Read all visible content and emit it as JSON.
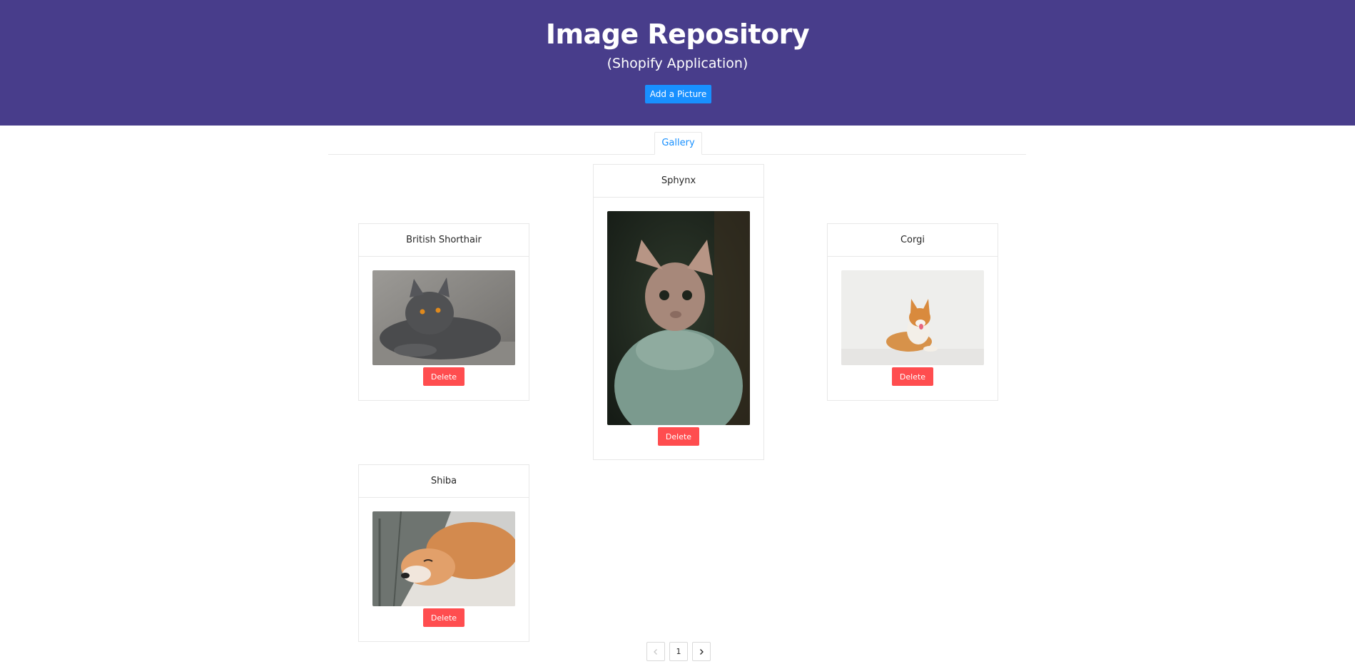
{
  "header": {
    "title": "Image Repository",
    "subtitle": "(Shopify Application)",
    "add_label": "Add a Picture",
    "bg_color": "#483d8b",
    "accent_color": "#1890ff"
  },
  "tabs": [
    {
      "label": "Gallery",
      "active": true
    }
  ],
  "gallery": {
    "cards": [
      {
        "title": "British Shorthair",
        "delete_label": "Delete",
        "image": "gray-cat-photo"
      },
      {
        "title": "Sphynx",
        "delete_label": "Delete",
        "image": "sphynx-cat-photo"
      },
      {
        "title": "Corgi",
        "delete_label": "Delete",
        "image": "corgi-dog-photo"
      },
      {
        "title": "Shiba",
        "delete_label": "Delete",
        "image": "shiba-dog-photo"
      }
    ],
    "delete_color": "#ff4d4f"
  },
  "pagination": {
    "prev_icon": "chevron-left-icon",
    "current_page": "1",
    "next_icon": "chevron-right-icon"
  }
}
